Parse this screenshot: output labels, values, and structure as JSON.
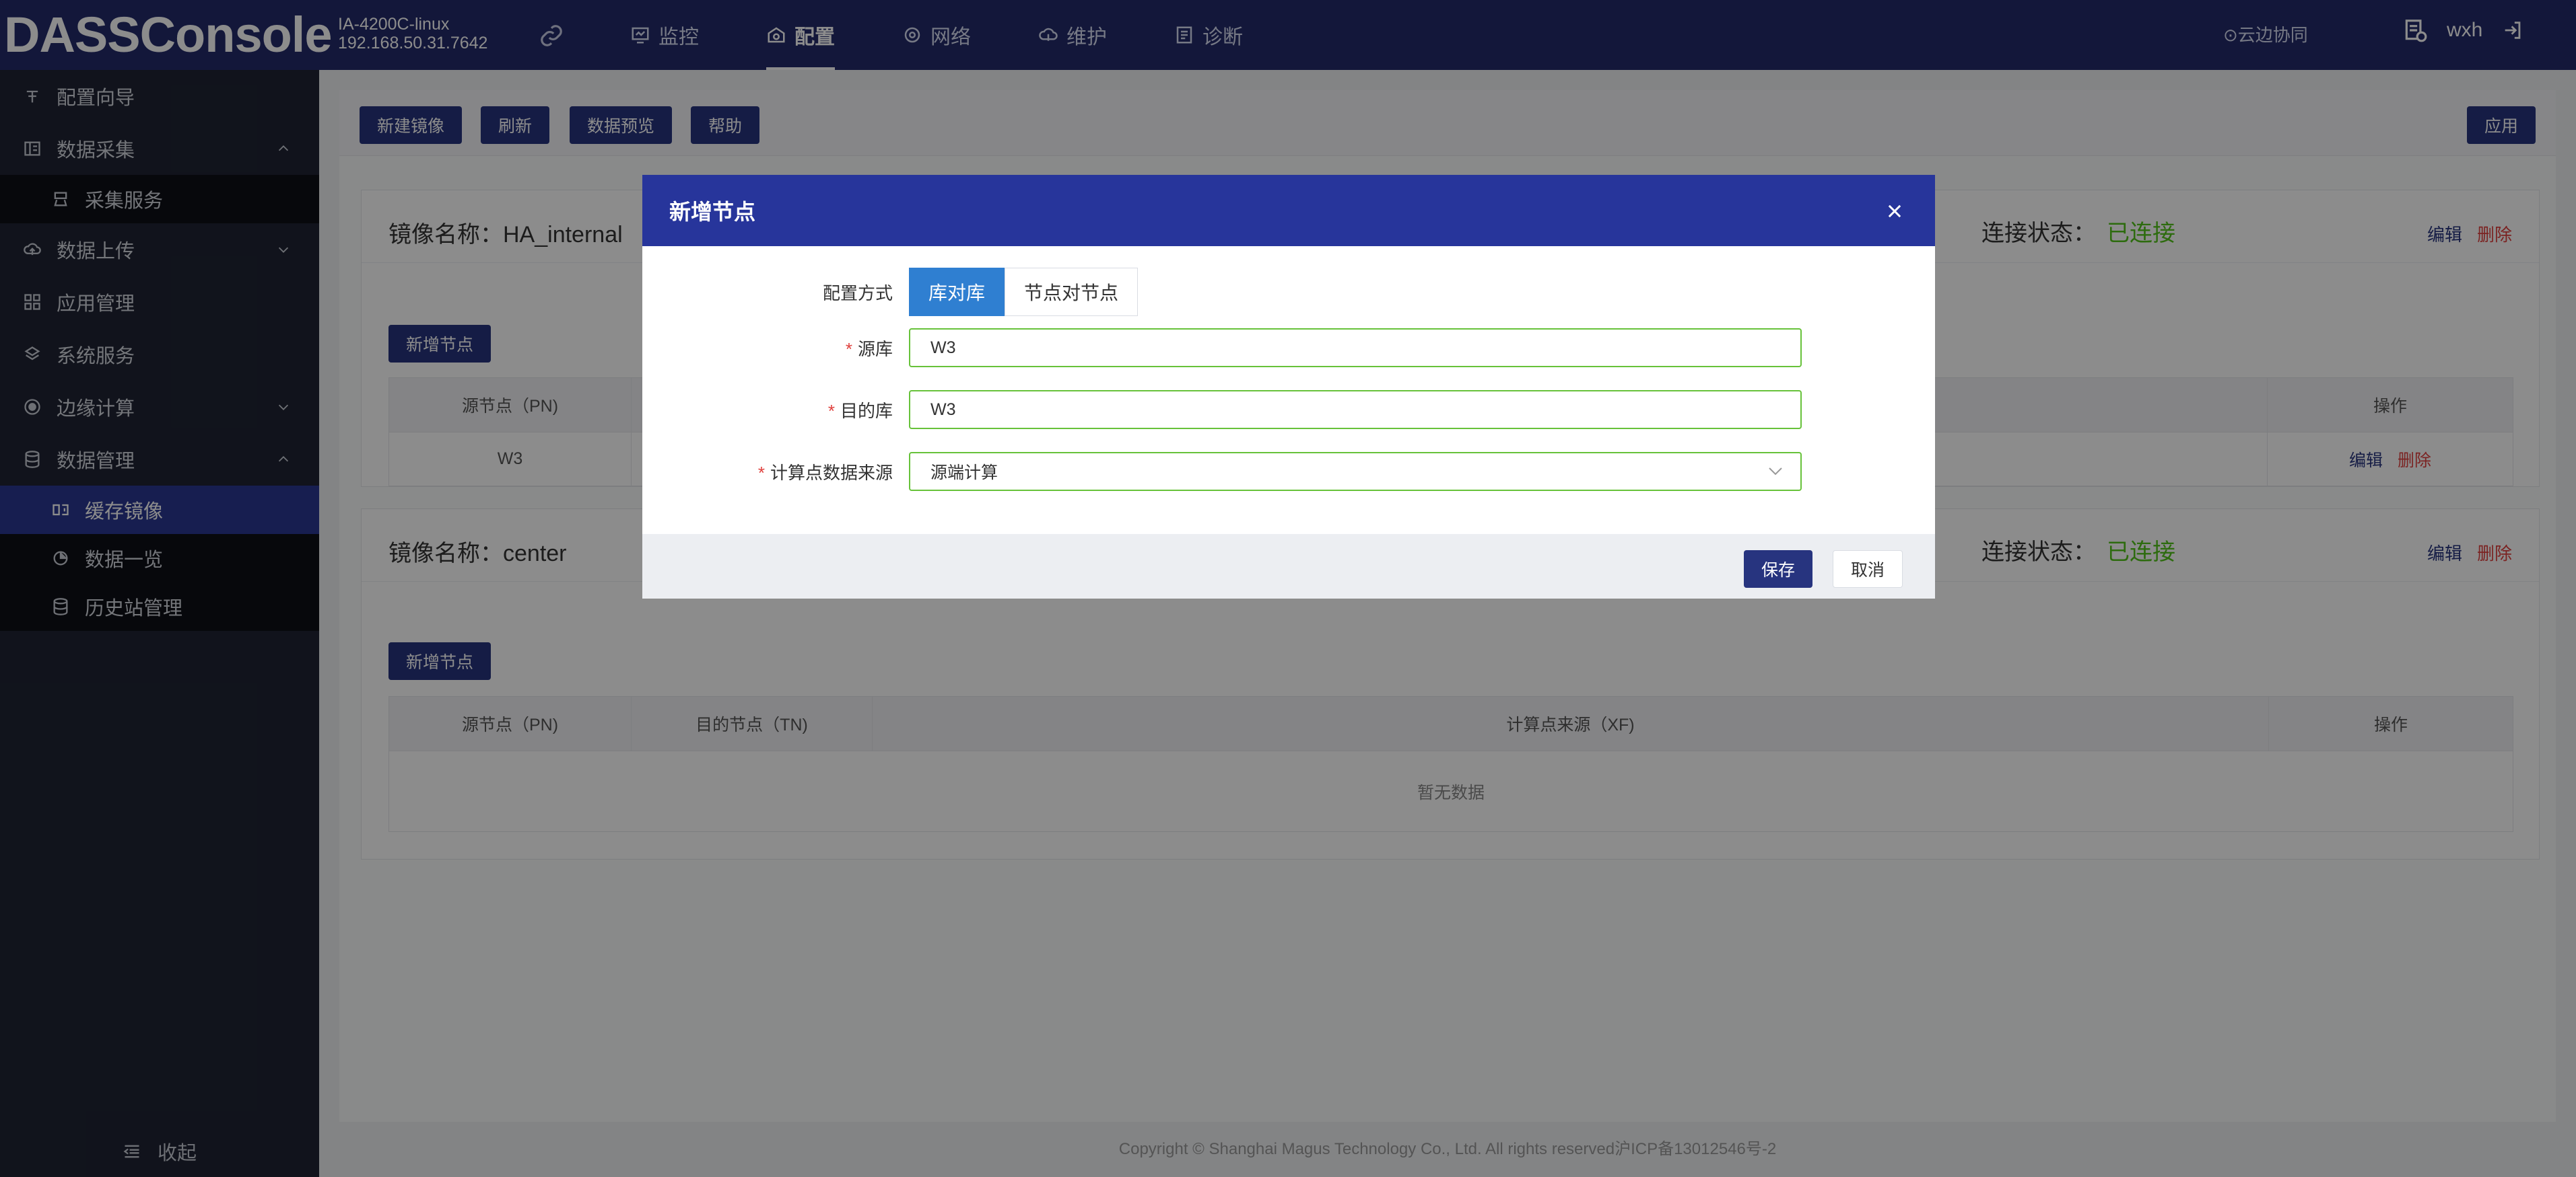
{
  "header": {
    "logo": "DASSConsole",
    "device_name": "IA-4200C-linux",
    "device_ip": "192.168.50.31.7642",
    "nav": [
      {
        "label": "监控",
        "icon": "monitor-icon"
      },
      {
        "label": "配置",
        "icon": "config-icon",
        "active": true
      },
      {
        "label": "网络",
        "icon": "network-icon"
      },
      {
        "label": "维护",
        "icon": "maintain-icon"
      },
      {
        "label": "诊断",
        "icon": "diagnose-icon"
      }
    ],
    "cloud_label": "⊙云边协同",
    "username": "wxh"
  },
  "sidebar": {
    "items": [
      {
        "label": "配置向导",
        "icon": "wizard-icon"
      },
      {
        "label": "数据采集",
        "icon": "collect-icon",
        "expanded": true
      },
      {
        "label": "采集服务",
        "icon": "collect-service-icon",
        "sub": true
      },
      {
        "label": "数据上传",
        "icon": "upload-icon",
        "expanded": false
      },
      {
        "label": "应用管理",
        "icon": "apps-icon"
      },
      {
        "label": "系统服务",
        "icon": "system-icon"
      },
      {
        "label": "边缘计算",
        "icon": "edge-icon",
        "expanded": false
      },
      {
        "label": "数据管理",
        "icon": "database-icon",
        "expanded": true
      },
      {
        "label": "缓存镜像",
        "icon": "mirror-icon",
        "sub": true,
        "active": true
      },
      {
        "label": "数据一览",
        "icon": "overview-icon",
        "sub": true
      },
      {
        "label": "历史站管理",
        "icon": "history-icon",
        "sub": true
      }
    ],
    "collapse_label": "收起"
  },
  "toolbar": {
    "new_mirror": "新建镜像",
    "refresh": "刷新",
    "preview": "数据预览",
    "help": "帮助",
    "apply": "应用"
  },
  "mirrors": [
    {
      "name": "镜像名称：HA_internal",
      "conn_label": "连接状态：",
      "conn_value": "已连接",
      "edit": "编辑",
      "delete": "删除",
      "add_node": "新增节点",
      "col_pn": "源节点（PN)",
      "col_ops": "操作",
      "row_pn": "W3",
      "row_edit": "编辑",
      "row_delete": "删除"
    },
    {
      "name": "镜像名称：center",
      "conn_label": "连接状态：",
      "conn_value": "已连接",
      "edit": "编辑",
      "delete": "删除",
      "add_node": "新增节点",
      "col_pn": "源节点（PN)",
      "col_tn": "目的节点（TN)",
      "col_xf": "计算点来源（XF)",
      "col_ops": "操作",
      "empty": "暂无数据"
    }
  ],
  "footer": "Copyright © Shanghai Magus Technology Co., Ltd. All rights reserved沪ICP备13012546号-2",
  "modal": {
    "title": "新增节点",
    "config_label": "配置方式",
    "seg_db": "库对库",
    "seg_node": "节点对节点",
    "source_label": "源库",
    "source_value": "W3",
    "target_label": "目的库",
    "target_value": "W3",
    "calc_label": "计算点数据来源",
    "calc_value": "源端计算",
    "save": "保存",
    "cancel": "取消"
  }
}
